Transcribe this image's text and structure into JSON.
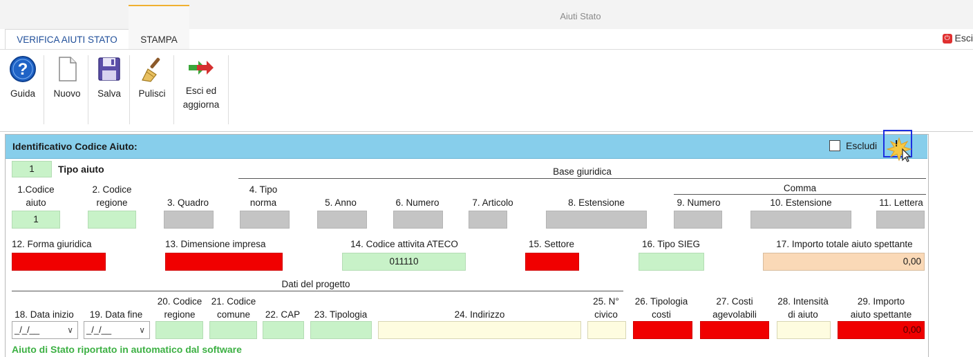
{
  "window": {
    "title": "Aiuti Stato",
    "exit_label": "Esci"
  },
  "tabs": [
    {
      "label": "VERIFICA AIUTI STATO"
    },
    {
      "label": "STAMPA"
    }
  ],
  "ribbon": {
    "guida": "Guida",
    "nuovo": "Nuovo",
    "salva": "Salva",
    "pulisci": "Pulisci",
    "esci_line1": "Esci ed",
    "esci_line2": "aggiorna"
  },
  "panel": {
    "title": "Identificativo Codice Aiuto:",
    "escludi_label": "Escludi",
    "escludi_checked": false,
    "warning_badge": "!",
    "tipo_aiuto_value": "1",
    "tipo_aiuto_label": "Tipo aiuto",
    "base_giuridica": "Base giuridica",
    "comma": "Comma"
  },
  "row1": {
    "f1_l1": "1.Codice",
    "f1_l2": "aiuto",
    "f1_value": "1",
    "f2_l1": "2. Codice",
    "f2_l2": "regione",
    "f3": "3. Quadro",
    "f4_l1": "4. Tipo",
    "f4_l2": "norma",
    "f5": "5. Anno",
    "f6": "6. Numero",
    "f7": "7. Articolo",
    "f8": "8. Estensione",
    "f9": "9. Numero",
    "f10": "10. Estensione",
    "f11": "11. Lettera"
  },
  "row2": {
    "f12": "12. Forma giuridica",
    "f13": "13. Dimensione impresa",
    "f14": "14. Codice attivita ATECO",
    "f14_value": "011110",
    "f15": "15. Settore",
    "f16": "16. Tipo SIEG",
    "f17": "17. Importo totale aiuto spettante",
    "f17_value": "0,00"
  },
  "row3": {
    "dati_progetto": "Dati del progetto",
    "f18": "18. Data inizio",
    "f18_value": "_/_/__",
    "f19": "19. Data fine",
    "f19_value": "_/_/__",
    "f20_l1": "20. Codice",
    "f20_l2": "regione",
    "f21_l1": "21. Codice",
    "f21_l2": "comune",
    "f22": "22. CAP",
    "f23": "23. Tipologia",
    "f24": "24. Indirizzo",
    "f25_l1": "25. N°",
    "f25_l2": "civico",
    "f26_l1": "26. Tipologia",
    "f26_l2": "costi",
    "f27_l1": "27. Costi",
    "f27_l2": "agevolabili",
    "f28_l1": "28. Intensità",
    "f28_l2": "di aiuto",
    "f29_l1": "29. Importo",
    "f29_l2": "aiuto spettante",
    "f29_value": "0,00"
  },
  "footer_note": "Aiuto di Stato riportato in automatico dal software",
  "colors": {
    "header_blue": "#87ceeb",
    "field_green": "#c8f2c8",
    "field_red": "#f00000",
    "field_gray": "#c4c4c4",
    "note_green": "#3cb043"
  }
}
